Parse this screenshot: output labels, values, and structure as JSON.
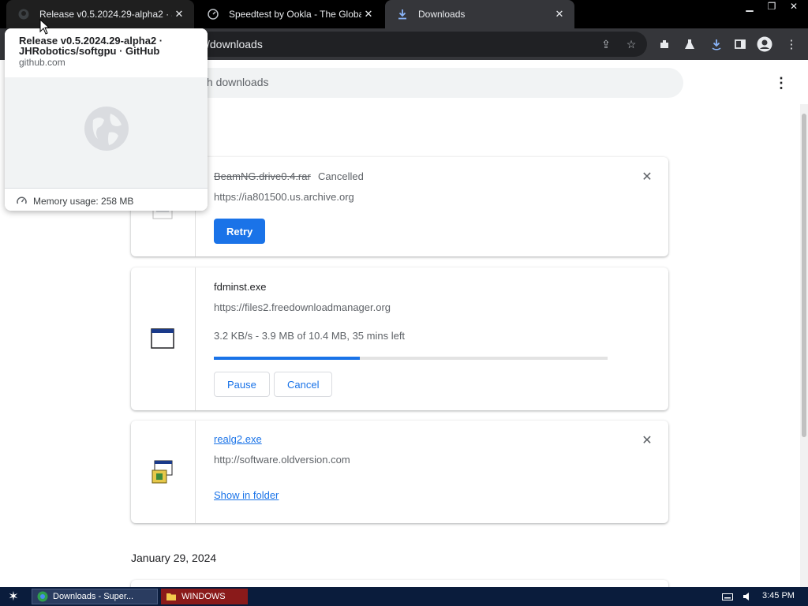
{
  "tabs": [
    {
      "title": "Release v0.5.2024.29-alpha2 · JHR",
      "icon": "github-icon",
      "state": "hovered"
    },
    {
      "title": "Speedtest by Ookla - The Global Br",
      "icon": "speedtest-icon",
      "state": "inactive"
    },
    {
      "title": "Downloads",
      "icon": "download-icon",
      "state": "active"
    }
  ],
  "omnibox": {
    "url": "/downloads"
  },
  "search": {
    "placeholder": "th downloads"
  },
  "downloads": [
    {
      "filename": "BeamNG.drive0.4.rar",
      "status": "Cancelled",
      "url": "https://ia801500.us.archive.org",
      "action": "Retry",
      "icon": "document-icon"
    },
    {
      "filename": "fdminst.exe",
      "url": "https://files2.freedownloadmanager.org",
      "progress_text": "3.2 KB/s - 3.9 MB of 10.4 MB, 35 mins left",
      "progress_fraction": 0.37,
      "actions": [
        "Pause",
        "Cancel"
      ],
      "icon": "window-app-icon"
    },
    {
      "filename": "realg2.exe",
      "url": "http://software.oldversion.com",
      "link": "Show in folder",
      "icon": "installer-icon"
    }
  ],
  "date_header": "January 29, 2024",
  "hovercard": {
    "title": "Release v0.5.2024.29-alpha2 · JHRobotics/softgpu · GitHub",
    "domain": "github.com",
    "memory": "Memory usage: 258 MB"
  },
  "taskbar": {
    "items": [
      {
        "label": "Downloads - Super...",
        "icon": "chrome-icon",
        "active": true
      },
      {
        "label": "WINDOWS",
        "icon": "folder-icon",
        "active": false
      }
    ],
    "clock": "3:45 PM"
  },
  "colors": {
    "accent": "#1a73e8",
    "tabstrip": "#000000",
    "toolbar": "#35363a",
    "taskbar": "#0a1c3c"
  }
}
